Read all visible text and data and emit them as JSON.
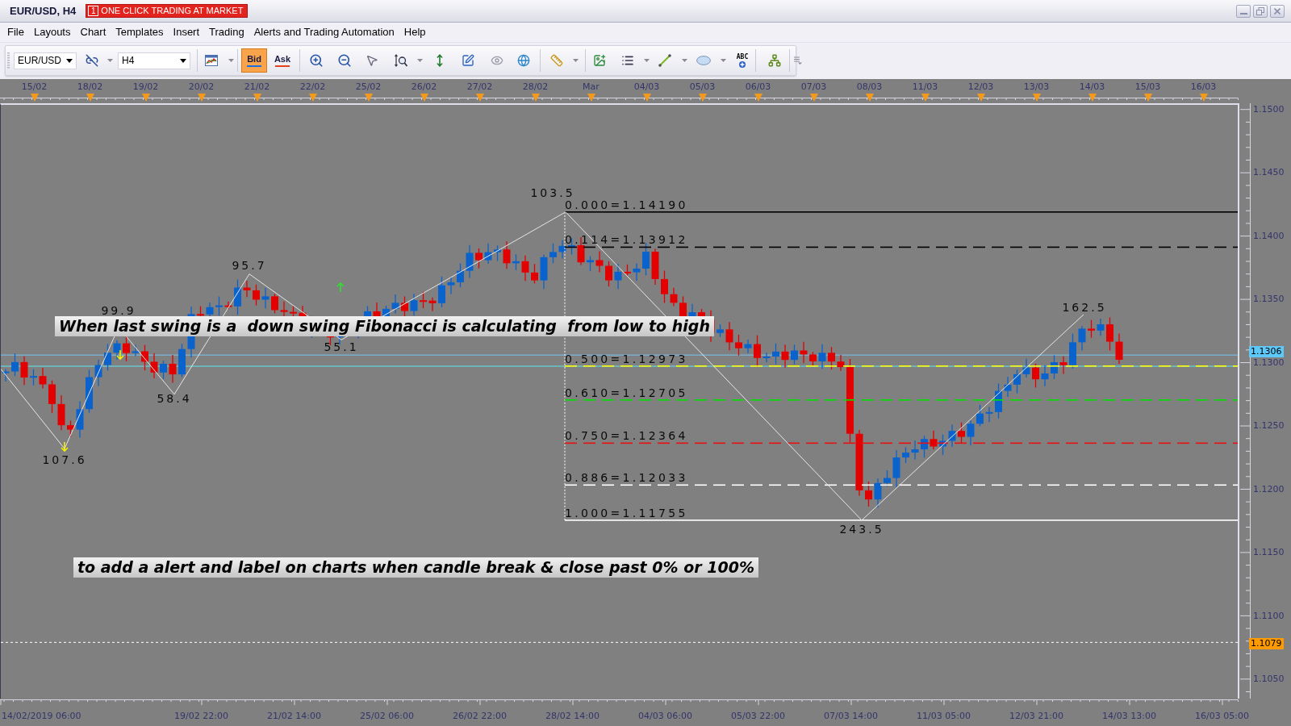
{
  "window": {
    "title": "EUR/USD, H4",
    "one_click_count": "1",
    "one_click_label": "ONE CLICK TRADING AT MARKET"
  },
  "menu": [
    "File",
    "Layouts",
    "Chart",
    "Templates",
    "Insert",
    "Trading",
    "Alerts and Trading Automation",
    "Help"
  ],
  "toolbar": {
    "symbol": "EUR/USD",
    "timeframe": "H4",
    "quote_buttons": [
      {
        "label": "Bid",
        "kind": "bid",
        "selected": true
      },
      {
        "label": "Ask",
        "kind": "ask",
        "selected": false
      }
    ],
    "text_tool_label": "ABC"
  },
  "chart": {
    "date_labels": [
      "15/02",
      "18/02",
      "19/02",
      "20/02",
      "21/02",
      "22/02",
      "25/02",
      "26/02",
      "27/02",
      "28/02",
      "Mar",
      "04/03",
      "05/03",
      "06/03",
      "07/03",
      "08/03",
      "11/03",
      "12/03",
      "13/03",
      "14/03",
      "15/03",
      "16/03"
    ],
    "price_labels": [
      "1.1500",
      "1.1450",
      "1.1400",
      "1.1350",
      "1.1300",
      "1.1250",
      "1.1200",
      "1.1150",
      "1.1100",
      "1.1050"
    ],
    "price_tags": [
      {
        "label": "1.1306",
        "color": "#5ec8f8"
      },
      {
        "label": "1.1079",
        "color": "#ff9a00"
      }
    ],
    "fib_levels": [
      {
        "label": "0.000=1.14190",
        "color": "#000000",
        "kind": "solid"
      },
      {
        "label": "0.114=1.13912",
        "color": "#000000",
        "kind": "dashed"
      },
      {
        "label": "0.500=1.12973",
        "color": "#ffff00",
        "kind": "dashed"
      },
      {
        "label": "0.610=1.12705",
        "color": "#00e000",
        "kind": "dashed"
      },
      {
        "label": "0.750=1.12364",
        "color": "#e81010",
        "kind": "dashed"
      },
      {
        "label": "0.886=1.12033",
        "color": "#ffffff",
        "kind": "dashed"
      },
      {
        "label": "1.000=1.11755",
        "color": "#ffffff",
        "kind": "solid"
      }
    ],
    "swing_labels": [
      "107.6",
      "99.9",
      "58.4",
      "95.7",
      "55.1",
      "103.5",
      "243.5",
      "162.5"
    ],
    "annotations": [
      "When last swing is a  down swing Fibonacci is calculating  from low to high",
      "to add a alert and label on charts when candle break & close past 0% or 100%"
    ],
    "time_labels": [
      "14/02/2019 06:00",
      "19/02 22:00",
      "21/02 14:00",
      "25/02 06:00",
      "26/02 22:00",
      "28/02 14:00",
      "04/03 06:00",
      "05/03 22:00",
      "07/03 14:00",
      "11/03 05:00",
      "12/03 21:00",
      "14/03 13:00",
      "16/03 05:00"
    ]
  }
}
